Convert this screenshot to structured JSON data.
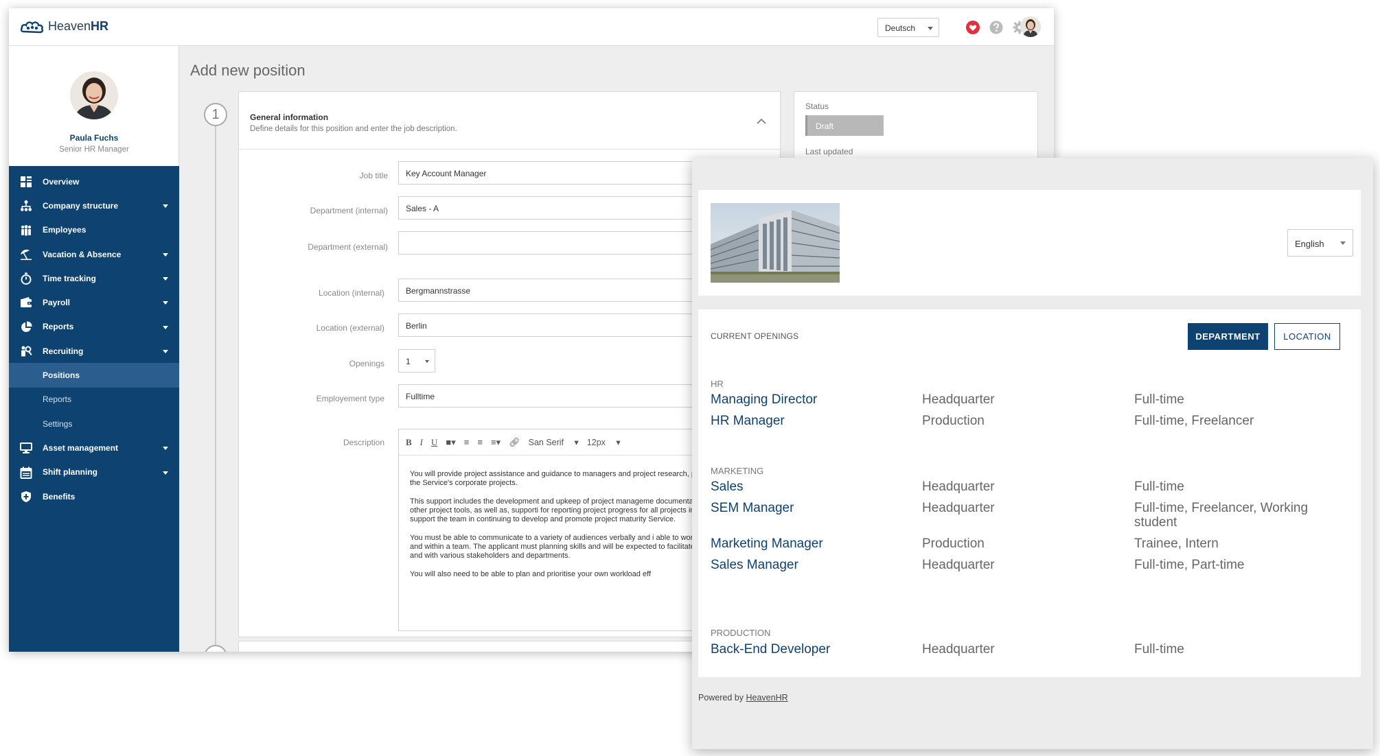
{
  "app": {
    "logo_prefix": "Heaven",
    "logo_suffix": "HR",
    "language": "Deutsch",
    "colors": {
      "brand": "#0e4270",
      "heart": "#e0323c",
      "sidebar": "#0e4270"
    },
    "icons": [
      "heart-icon",
      "help-icon",
      "gear-icon"
    ]
  },
  "profile": {
    "name": "Paula Fuchs",
    "role": "Senior HR Manager"
  },
  "nav": {
    "overview": "Overview",
    "company_structure": "Company structure",
    "employees": "Employees",
    "vacation": "Vacation & Absence",
    "time_tracking": "Time tracking",
    "payroll": "Payroll",
    "reports": "Reports",
    "recruiting": "Recruiting",
    "positions": "Positions",
    "rec_reports": "Reports",
    "settings": "Settings",
    "asset_management": "Asset management",
    "shift_planning": "Shift planning",
    "benefits": "Benefits"
  },
  "page": {
    "title": "Add new position",
    "step_number": "1",
    "section_title": "General information",
    "section_desc": "Define details for this position and enter the job description."
  },
  "form": {
    "job_title_label": "Job title",
    "job_title": "Key Account Manager",
    "dept_internal_label": "Department (internal)",
    "dept_internal": "Sales - A",
    "dept_external_label": "Department (external)",
    "dept_external": "",
    "loc_internal_label": "Location (internal)",
    "loc_internal": "Bergmannstrasse",
    "loc_external_label": "Location (external)",
    "loc_external": "Berlin",
    "openings_label": "Openings",
    "openings": "1",
    "employment_label": "Employement type",
    "employment": "Fulltime",
    "description_label": "Description",
    "font_name": "San Serif",
    "font_size": "12px",
    "description": [
      "You will provide project assistance and guidance to managers and project research, planning and delivery of the Service's corporate projects.",
      "This support includes the development and upkeep of project manageme documentation, project plans and other project tools, as well as, supporti for reporting project progress for all projects in the portfolio. You are als support the team in continuing to develop and promote project maturity Service.",
      "You must be able to communicate to a variety of audiences verbally and i able to work on your own initiative and within a team. The applicant must planning skills and will be expected to facilitate meetings, workshops and with various stakeholders and departments.",
      "You will also need to be able to plan and prioritise your own workload eff"
    ]
  },
  "status": {
    "label": "Status",
    "value": "Draft",
    "last_updated_label": "Last updated"
  },
  "career": {
    "language": "English",
    "openings_title": "CURRENT OPENINGS",
    "btn_department": "DEPARTMENT",
    "btn_location": "LOCATION",
    "groups": [
      {
        "name": "HR",
        "jobs": [
          {
            "title": "Managing Director",
            "location": "Headquarter",
            "type": "Full-time"
          },
          {
            "title": "HR Manager",
            "location": "Production",
            "type": "Full-time, Freelancer"
          }
        ]
      },
      {
        "name": "MARKETING",
        "jobs": [
          {
            "title": "Sales",
            "location": "Headquarter",
            "type": "Full-time"
          },
          {
            "title": "SEM Manager",
            "location": "Headquarter",
            "type": "Full-time, Freelancer, Working student"
          },
          {
            "title": "Marketing Manager",
            "location": "Production",
            "type": "Trainee, Intern"
          },
          {
            "title": "Sales Manager",
            "location": "Headquarter",
            "type": "Full-time, Part-time"
          }
        ]
      },
      {
        "name": "PRODUCTION",
        "jobs": [
          {
            "title": "Back-End Developer",
            "location": "Headquarter",
            "type": "Full-time"
          }
        ]
      }
    ],
    "powered_prefix": "Powered by ",
    "powered_link": "HeavenHR"
  }
}
